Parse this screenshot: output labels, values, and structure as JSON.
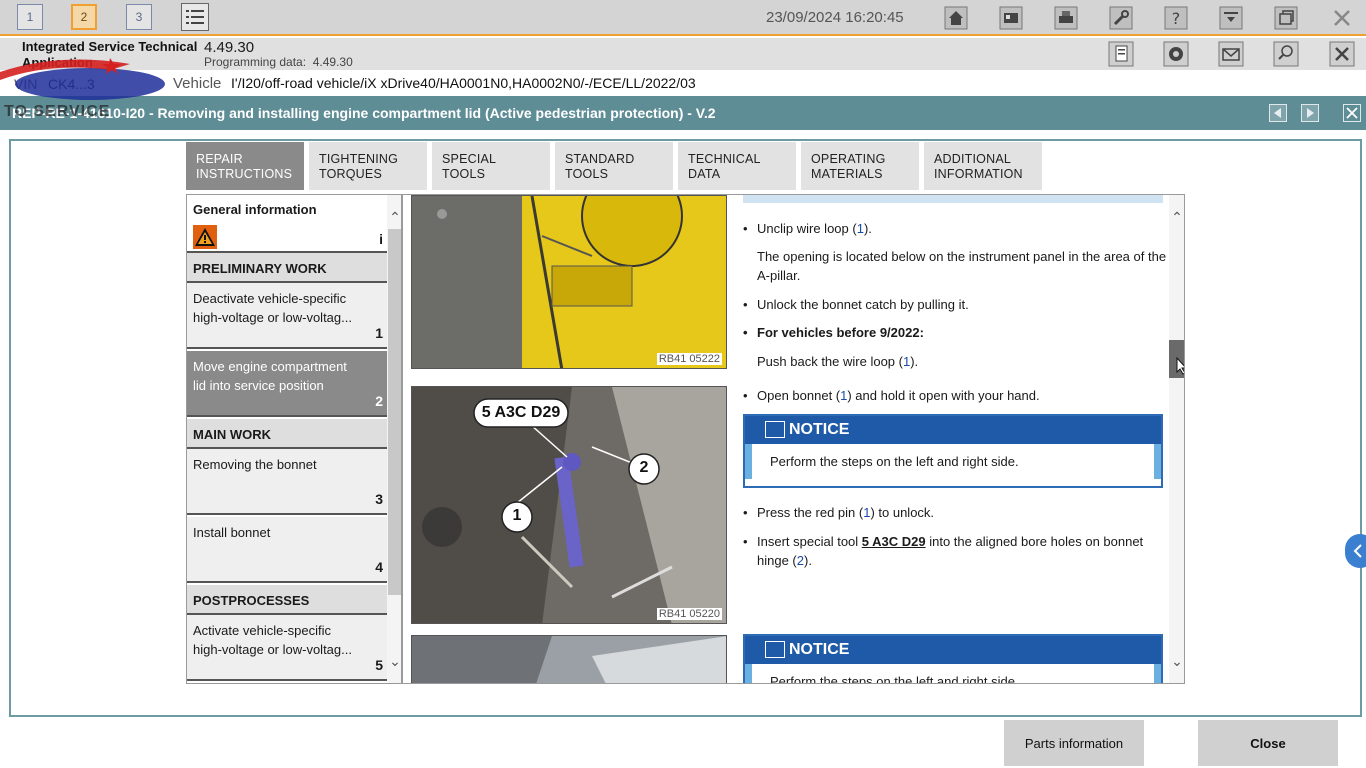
{
  "workspaces": [
    "1",
    "2",
    "3"
  ],
  "datetime": "23/09/2024 16:20:45",
  "app": {
    "name_line1": "Integrated Service Technical",
    "name_line2": "Application",
    "version": "4.49.30",
    "programming_label": "Programming data:",
    "programming_value": "4.49.30"
  },
  "vehicle": {
    "vin_label": "VIN",
    "vin_value": "CK4...3",
    "label": "Vehicle",
    "value": "I'/I20/off-road vehicle/iX xDrive40/HA0001N0,HA0002N0/-/ECE/LL/2022/03"
  },
  "document": {
    "title": "REP-RE-1-41610-I20 - Removing and installing engine compartment lid (Active pedestrian protection) - V.2"
  },
  "tabs": [
    {
      "line1": "REPAIR",
      "line2": "INSTRUCTIONS"
    },
    {
      "line1": "TIGHTENING",
      "line2": "TORQUES"
    },
    {
      "line1": "SPECIAL TOOLS",
      "line2": ""
    },
    {
      "line1": "STANDARD",
      "line2": "TOOLS"
    },
    {
      "line1": "TECHNICAL",
      "line2": "DATA"
    },
    {
      "line1": "OPERATING",
      "line2": "MATERIALS"
    },
    {
      "line1": "ADDITIONAL",
      "line2": "INFORMATION"
    }
  ],
  "nav": {
    "general": "General information",
    "general_badge": "i",
    "sections": {
      "preliminary": "PRELIMINARY WORK",
      "main": "MAIN WORK",
      "post": "POSTPROCESSES"
    },
    "items": [
      {
        "line1": "Deactivate vehicle-specific",
        "line2": "high-voltage or low-voltag...",
        "num": "1"
      },
      {
        "line1": "Move engine compartment",
        "line2": "lid into service position",
        "num": "2"
      },
      {
        "line1": "Removing the bonnet",
        "line2": "",
        "num": "3"
      },
      {
        "line1": "Install bonnet",
        "line2": "",
        "num": "4"
      },
      {
        "line1": "Activate vehicle-specific",
        "line2": "high-voltage or low-voltag...",
        "num": "5"
      }
    ]
  },
  "content": {
    "img1_caption": "RB41 05222",
    "img2_caption": "RB41 05220",
    "img2_tool_label": "5 A3C D29",
    "img2_callout1": "1",
    "img2_callout2": "2",
    "steps": {
      "s1_a": "Unclip wire loop (",
      "s1_link": "1",
      "s1_b": ").",
      "s1_note": "The opening is located below on the instrument panel in the area of the A-pillar.",
      "s2": "Unlock the bonnet catch by pulling it.",
      "s3": "For vehicles before 9/2022:",
      "s3_note_a": "Push back the wire loop (",
      "s3_note_link": "1",
      "s3_note_b": ").",
      "s4_a": "Open bonnet (",
      "s4_link": "1",
      "s4_b": ") and hold it open with your hand.",
      "notice_title": "NOTICE",
      "notice_text": "Perform the steps on the left and right side.",
      "s5_a": "Press the red pin (",
      "s5_link": "1",
      "s5_b": ") to unlock.",
      "s6_a": "Insert special tool ",
      "s6_tool": "5 A3C D29",
      "s6_b": " into the aligned bore holes on bonnet hinge (",
      "s6_link": "2",
      "s6_c": ").",
      "notice2_title": "NOTICE",
      "notice2_text": "Perform the steps on the left and right side."
    }
  },
  "buttons": {
    "parts": "Parts information",
    "close": "Close"
  },
  "colors": {
    "accent_orange": "#f0a030",
    "title_bar": "#5f8d96",
    "notice_blue": "#1e5aa8",
    "link": "#1a4aa8"
  }
}
